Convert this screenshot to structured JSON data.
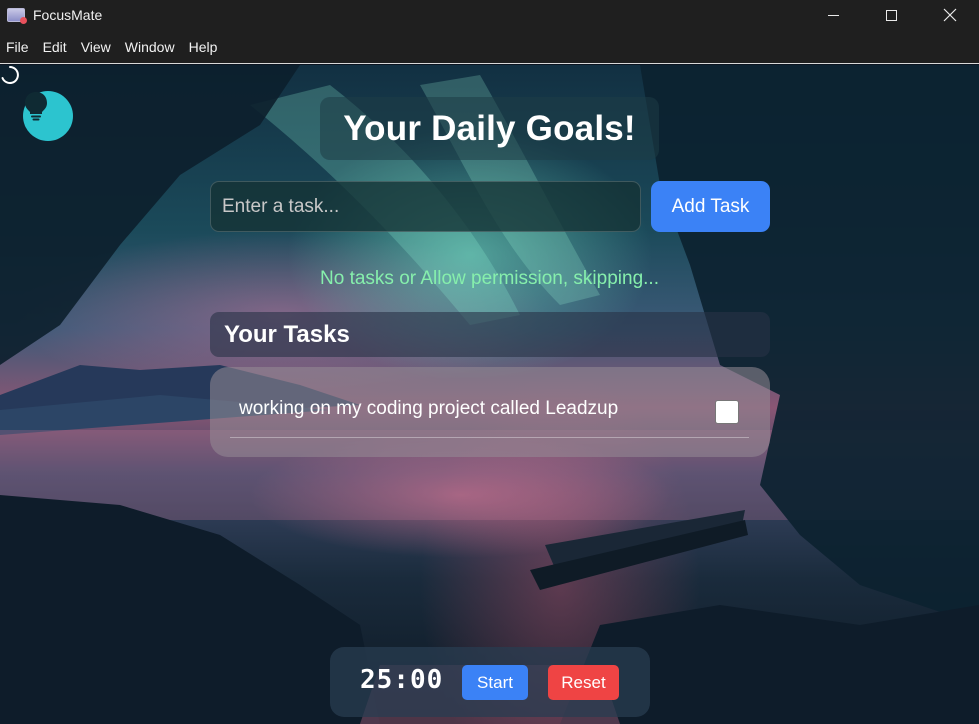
{
  "window": {
    "title": "FocusMate",
    "icon": "app-notepad-icon"
  },
  "menu": {
    "items": [
      "File",
      "Edit",
      "View",
      "Window",
      "Help"
    ]
  },
  "header": {
    "title": "Your Daily Goals!"
  },
  "task_input": {
    "placeholder": "Enter a task...",
    "value": "",
    "add_label": "Add Task"
  },
  "status": {
    "message": "No tasks or Allow permission, skipping..."
  },
  "tasks": {
    "heading": "Your Tasks",
    "items": [
      {
        "text": "working on my coding project called Leadzup",
        "done": false
      }
    ]
  },
  "timer": {
    "display": "25:00",
    "start_label": "Start",
    "reset_label": "Reset"
  },
  "colors": {
    "accent_blue": "#3b82f6",
    "reset_red": "#ef4444",
    "status_green": "#86efac",
    "bulb_teal": "#2cc4cf",
    "titlebar": "#1f1f1f"
  }
}
